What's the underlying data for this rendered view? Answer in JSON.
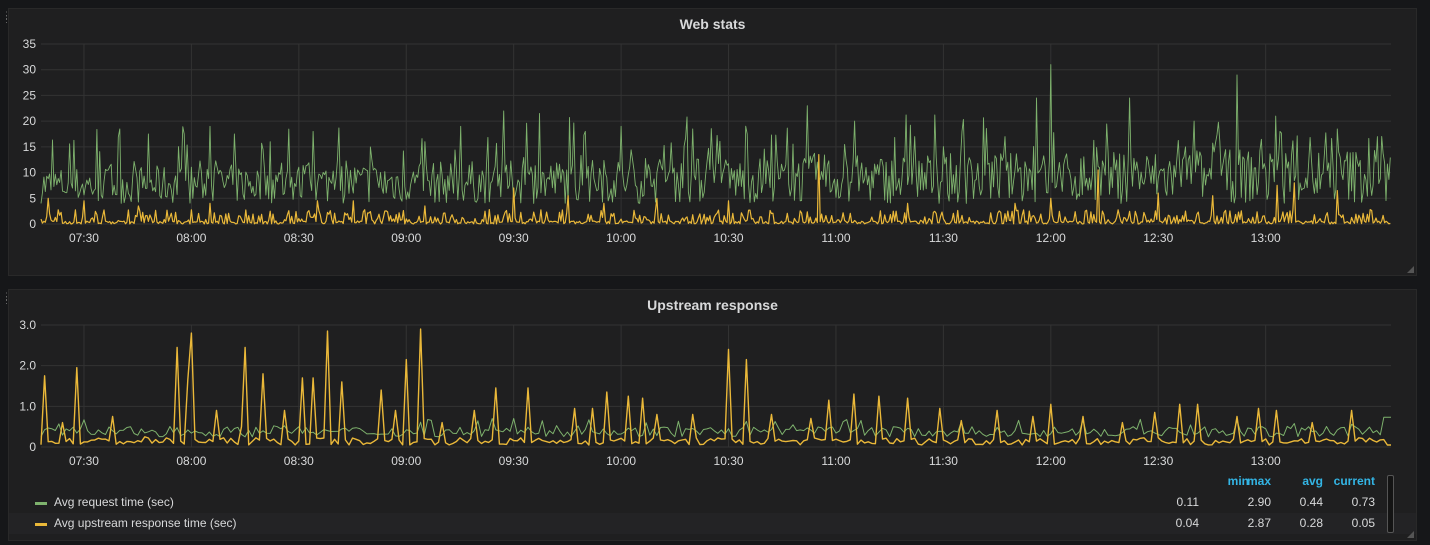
{
  "panels": [
    {
      "title": "Web stats",
      "chart_data": {
        "type": "line",
        "title": "Web stats",
        "xlim": [
          "07:18",
          "13:35"
        ],
        "ylim": [
          0,
          35
        ],
        "ytick_labels": [
          "0",
          "5",
          "10",
          "15",
          "20",
          "25",
          "30",
          "35"
        ],
        "xtick_labels": [
          "07:30",
          "08:00",
          "08:30",
          "09:00",
          "09:30",
          "10:00",
          "10:30",
          "11:00",
          "11:30",
          "12:00",
          "12:30",
          "13:00"
        ],
        "grid": true,
        "series": [
          {
            "color": "#7eb26d",
            "peaks": [
              [
                "07:40",
                18.5
              ],
              [
                "07:48",
                17.5
              ],
              [
                "07:58",
                17.5
              ],
              [
                "08:05",
                19
              ],
              [
                "08:12",
                17.5
              ],
              [
                "08:22",
                16
              ],
              [
                "08:34",
                18
              ],
              [
                "08:50",
                15
              ],
              [
                "09:05",
                16
              ],
              [
                "09:15",
                19
              ],
              [
                "09:27",
                22
              ],
              [
                "09:37",
                21.5
              ],
              [
                "09:50",
                18
              ],
              [
                "10:00",
                19
              ],
              [
                "10:20",
                18.5
              ],
              [
                "10:35",
                17.5
              ],
              [
                "10:52",
                23
              ],
              [
                "11:05",
                20
              ],
              [
                "11:22",
                17
              ],
              [
                "11:35",
                18
              ],
              [
                "11:47",
                17
              ],
              [
                "11:56",
                24.5
              ],
              [
                "12:00",
                31
              ],
              [
                "12:22",
                24.5
              ],
              [
                "12:40",
                20
              ],
              [
                "12:52",
                29
              ],
              [
                "13:04",
                18
              ],
              [
                "13:20",
                18.5
              ],
              [
                "13:31",
                17
              ]
            ]
          },
          {
            "color": "#eab839",
            "peaks": [
              [
                "07:20",
                5
              ],
              [
                "07:30",
                4.5
              ],
              [
                "07:45",
                3.5
              ],
              [
                "08:05",
                4
              ],
              [
                "08:35",
                4.5
              ],
              [
                "08:45",
                4.5
              ],
              [
                "09:05",
                3.5
              ],
              [
                "09:30",
                7
              ],
              [
                "09:45",
                5.5
              ],
              [
                "09:55",
                4
              ],
              [
                "10:10",
                5
              ],
              [
                "10:30",
                4.5
              ],
              [
                "10:55",
                13.5
              ],
              [
                "11:20",
                4
              ],
              [
                "11:50",
                4
              ],
              [
                "12:00",
                5
              ],
              [
                "12:13",
                10.5
              ],
              [
                "12:30",
                6
              ],
              [
                "12:45",
                5.5
              ],
              [
                "13:03",
                7.5
              ],
              [
                "13:08",
                8
              ],
              [
                "13:20",
                6.5
              ]
            ]
          }
        ]
      }
    },
    {
      "title": "Upstream response",
      "chart_data": {
        "type": "line",
        "title": "Upstream response",
        "xlim": [
          "07:18",
          "13:35"
        ],
        "ylim": [
          0,
          3.0
        ],
        "ytick_labels": [
          "0",
          "1.0",
          "2.0",
          "3.0"
        ],
        "xtick_labels": [
          "07:30",
          "08:00",
          "08:30",
          "09:00",
          "09:30",
          "10:00",
          "10:30",
          "11:00",
          "11:30",
          "12:00",
          "12:30",
          "13:00"
        ],
        "grid": true,
        "series": [
          {
            "name": "Avg request time (sec)",
            "color": "#7eb26d",
            "values_range": [
              0.11,
              2.9
            ],
            "avg": 0.44,
            "current": 0.73
          },
          {
            "name": "Avg upstream response time (sec)",
            "color": "#eab839",
            "spikes": [
              [
                "07:19",
                1.75
              ],
              [
                "07:24",
                0.6
              ],
              [
                "07:28",
                1.95
              ],
              [
                "07:38",
                0.75
              ],
              [
                "07:47",
                0.25
              ],
              [
                "07:56",
                2.45
              ],
              [
                "07:59",
                1.65
              ],
              [
                "08:00",
                2.8
              ],
              [
                "08:07",
                0.9
              ],
              [
                "08:14",
                0.5
              ],
              [
                "08:15",
                2.45
              ],
              [
                "08:20",
                1.8
              ],
              [
                "08:26",
                0.9
              ],
              [
                "08:31",
                1.7
              ],
              [
                "08:34",
                1.7
              ],
              [
                "08:38",
                2.85
              ],
              [
                "08:42",
                1.6
              ],
              [
                "08:53",
                1.4
              ],
              [
                "08:57",
                0.9
              ],
              [
                "09:00",
                2.15
              ],
              [
                "09:04",
                2.9
              ],
              [
                "09:10",
                0.6
              ],
              [
                "09:19",
                0.9
              ],
              [
                "09:25",
                1.45
              ],
              [
                "09:34",
                1.45
              ],
              [
                "09:47",
                0.95
              ],
              [
                "09:52",
                0.95
              ],
              [
                "09:56",
                1.35
              ],
              [
                "10:02",
                1.25
              ],
              [
                "10:06",
                1.2
              ],
              [
                "10:10",
                0.8
              ],
              [
                "10:20",
                0.8
              ],
              [
                "10:30",
                2.4
              ],
              [
                "10:35",
                2.15
              ],
              [
                "10:42",
                0.8
              ],
              [
                "10:53",
                0.7
              ],
              [
                "10:58",
                1.15
              ],
              [
                "11:05",
                1.3
              ],
              [
                "11:12",
                1.25
              ],
              [
                "11:20",
                1.2
              ],
              [
                "11:29",
                0.95
              ],
              [
                "11:35",
                0.65
              ],
              [
                "11:45",
                0.9
              ],
              [
                "11:55",
                0.75
              ],
              [
                "12:00",
                1.05
              ],
              [
                "12:09",
                0.75
              ],
              [
                "12:20",
                0.6
              ],
              [
                "12:29",
                0.85
              ],
              [
                "12:36",
                1.05
              ],
              [
                "12:41",
                1.05
              ],
              [
                "12:52",
                0.75
              ],
              [
                "12:58",
                0.95
              ],
              [
                "13:03",
                0.9
              ],
              [
                "13:13",
                0.6
              ],
              [
                "13:24",
                0.9
              ]
            ],
            "values_range": [
              0.04,
              2.87
            ],
            "avg": 0.28,
            "current": 0.05
          }
        ]
      },
      "legend": {
        "headers": {
          "min": "min",
          "max": "max",
          "avg": "avg",
          "current": "current"
        },
        "rows": [
          {
            "name": "Avg request time (sec)",
            "color": "#7eb26d",
            "min": "0.11",
            "max": "2.90",
            "avg": "0.44",
            "current": "0.73"
          },
          {
            "name": "Avg upstream response time (sec)",
            "color": "#eab839",
            "min": "0.04",
            "max": "2.87",
            "avg": "0.28",
            "current": "0.05"
          }
        ]
      }
    }
  ]
}
